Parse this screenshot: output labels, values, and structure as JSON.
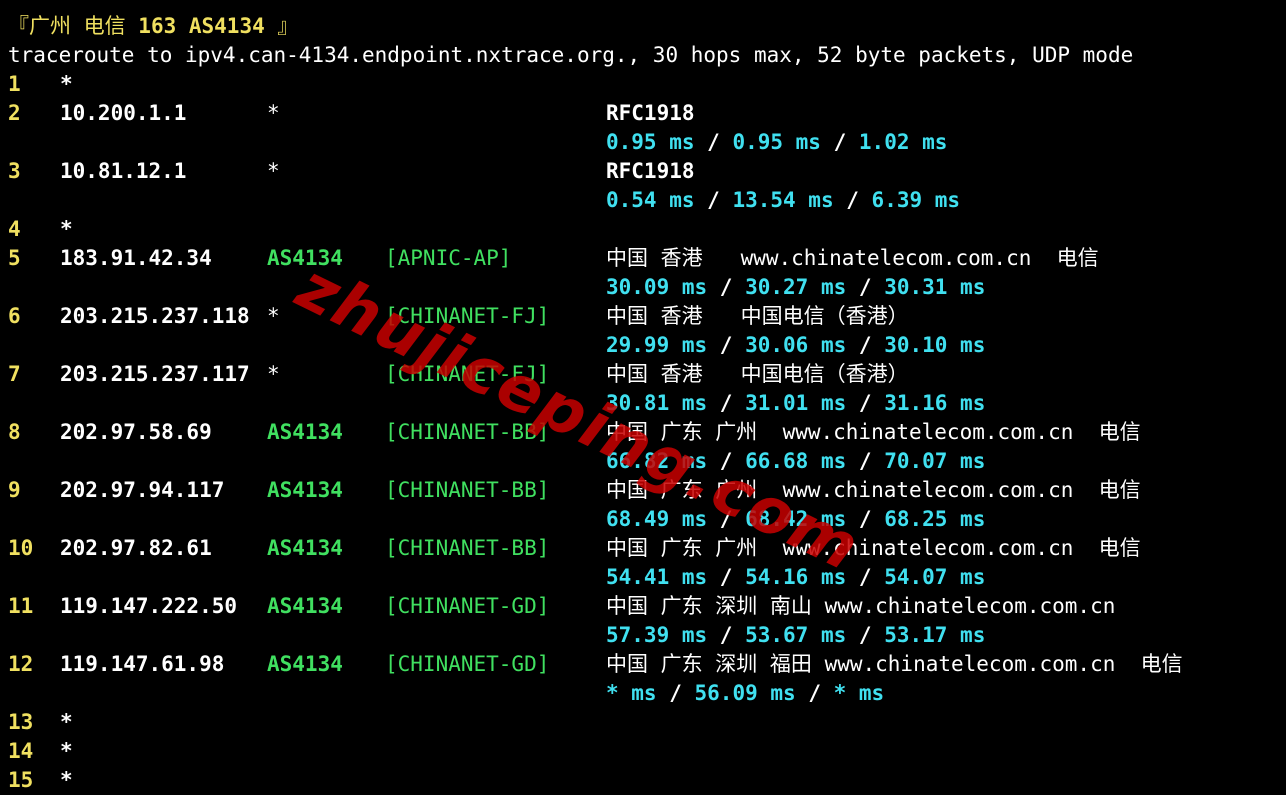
{
  "header": {
    "title_open": "『广州 电信 ",
    "title_bold": "163 AS4134",
    "title_close": " 』",
    "command": "traceroute to ipv4.can-4134.endpoint.nxtrace.org., 30 hops max, 52 byte packets, UDP mode"
  },
  "watermark": "zhujiceping.com",
  "hops": [
    {
      "num": "1",
      "ip": "*"
    },
    {
      "num": "2",
      "ip": "10.200.1.1",
      "asn": "*",
      "asn_star": true,
      "net": "",
      "geo": "RFC1918",
      "geo_bold": true,
      "rtt": [
        "0.95 ms",
        "0.95 ms",
        "1.02 ms"
      ]
    },
    {
      "num": "3",
      "ip": "10.81.12.1",
      "asn": "*",
      "asn_star": true,
      "net": "",
      "geo": "RFC1918",
      "geo_bold": true,
      "rtt": [
        "0.54 ms",
        "13.54 ms",
        "6.39 ms"
      ]
    },
    {
      "num": "4",
      "ip": "*"
    },
    {
      "num": "5",
      "ip": "183.91.42.34",
      "asn": "AS4134",
      "net": "[APNIC-AP]",
      "geo": "中国 香港   www.chinatelecom.com.cn  电信",
      "rtt": [
        "30.09 ms",
        "30.27 ms",
        "30.31 ms"
      ]
    },
    {
      "num": "6",
      "ip": "203.215.237.118",
      "asn": "*",
      "asn_star": true,
      "net": "[CHINANET-FJ]",
      "geo": "中国 香港   中国电信（香港）",
      "rtt": [
        "29.99 ms",
        "30.06 ms",
        "30.10 ms"
      ]
    },
    {
      "num": "7",
      "ip": "203.215.237.117",
      "asn": "*",
      "asn_star": true,
      "net": "[CHINANET-FJ]",
      "geo": "中国 香港   中国电信（香港）",
      "rtt": [
        "30.81 ms",
        "31.01 ms",
        "31.16 ms"
      ]
    },
    {
      "num": "8",
      "ip": "202.97.58.69",
      "asn": "AS4134",
      "net": "[CHINANET-BB]",
      "geo": "中国 广东 广州  www.chinatelecom.com.cn  电信",
      "rtt": [
        "66.82 ms",
        "66.68 ms",
        "70.07 ms"
      ]
    },
    {
      "num": "9",
      "ip": "202.97.94.117",
      "asn": "AS4134",
      "net": "[CHINANET-BB]",
      "geo": "中国 广东 广州  www.chinatelecom.com.cn  电信",
      "rtt": [
        "68.49 ms",
        "68.42 ms",
        "68.25 ms"
      ]
    },
    {
      "num": "10",
      "ip": "202.97.82.61",
      "asn": "AS4134",
      "net": "[CHINANET-BB]",
      "geo": "中国 广东 广州  www.chinatelecom.com.cn  电信",
      "rtt": [
        "54.41 ms",
        "54.16 ms",
        "54.07 ms"
      ]
    },
    {
      "num": "11",
      "ip": "119.147.222.50",
      "asn": "AS4134",
      "net": "[CHINANET-GD]",
      "geo": "中国 广东 深圳 南山 www.chinatelecom.com.cn",
      "rtt": [
        "57.39 ms",
        "53.67 ms",
        "53.17 ms"
      ]
    },
    {
      "num": "12",
      "ip": "119.147.61.98",
      "asn": "AS4134",
      "net": "[CHINANET-GD]",
      "geo": "中国 广东 深圳 福田 www.chinatelecom.com.cn  电信",
      "rtt": [
        "* ms",
        "56.09 ms",
        "* ms"
      ]
    },
    {
      "num": "13",
      "ip": "*"
    },
    {
      "num": "14",
      "ip": "*"
    },
    {
      "num": "15",
      "ip": "*"
    }
  ]
}
